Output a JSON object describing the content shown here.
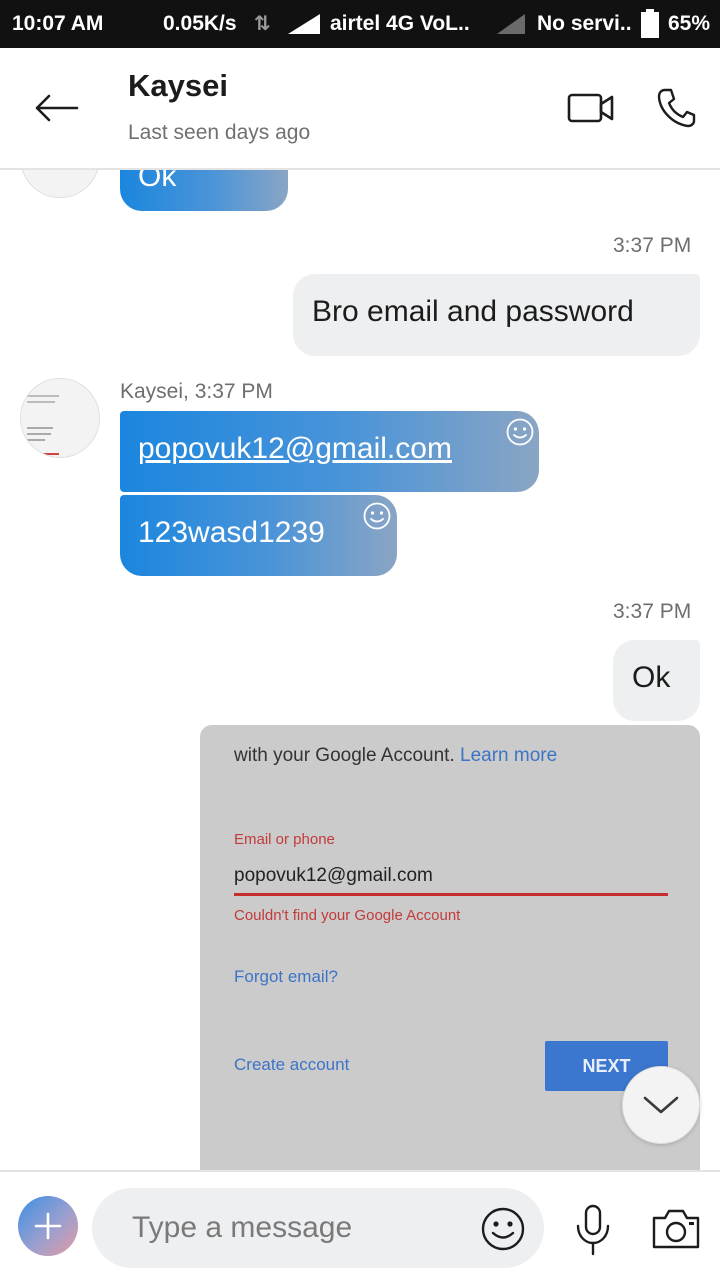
{
  "status_bar": {
    "time": "10:07 AM",
    "net_speed": "0.05K/s",
    "carrier": "airtel 4G VoL..",
    "sim2": "No servi..",
    "battery": "65%"
  },
  "header": {
    "contact_name": "Kaysei",
    "last_seen": "Last seen days ago"
  },
  "messages": {
    "prev_in": "Ok",
    "time_1": "3:37 PM",
    "out_1": "Bro email and password",
    "sender_line": "Kaysei, 3:37 PM",
    "in_email": "popovuk12@gmail.com",
    "in_password": "123wasd1239",
    "time_2": "3:37 PM",
    "out_2": "Ok"
  },
  "screenshot": {
    "line1": "with your Google Account.",
    "learn_more": "Learn more",
    "field_label": "Email or phone",
    "field_value": "popovuk12@gmail.com",
    "error": "Couldn't find your Google Account",
    "forgot": "Forgot email?",
    "create": "Create account",
    "next": "NEXT"
  },
  "composer": {
    "placeholder": "Type a message"
  },
  "colors": {
    "accent": "#1b86de",
    "bubble_out": "#eeeff1",
    "error": "#c62d2d"
  },
  "icons": [
    "back-arrow-icon",
    "video-call-icon",
    "phone-icon",
    "emoji-react-icon",
    "chevron-down-icon",
    "plus-icon",
    "emoji-icon",
    "microphone-icon",
    "camera-icon"
  ]
}
